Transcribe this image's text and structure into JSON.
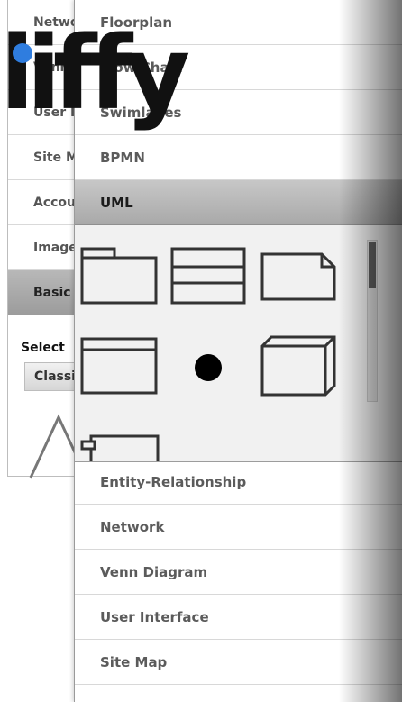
{
  "background_menu": {
    "items": [
      {
        "label": "Network"
      },
      {
        "label": "Venn Diagram"
      },
      {
        "label": "User Interface"
      },
      {
        "label": "Site Map"
      },
      {
        "label": "Account"
      },
      {
        "label": "Images"
      },
      {
        "label": "Basic"
      }
    ],
    "select_title": "Select",
    "select_value": "Classic"
  },
  "logo": {
    "text": "liffy",
    "brand_color": "#2f7ddf"
  },
  "menu": {
    "top_items": [
      {
        "label": "Floorplan"
      },
      {
        "label": "Flow Chart"
      },
      {
        "label": "Swimlanes"
      },
      {
        "label": "BPMN"
      },
      {
        "label": "UML"
      }
    ],
    "bottom_items": [
      {
        "label": "Entity-Relationship"
      },
      {
        "label": "Network"
      },
      {
        "label": "Venn Diagram"
      },
      {
        "label": "User Interface"
      },
      {
        "label": "Site Map"
      }
    ]
  },
  "uml_shapes": [
    {
      "name": "package-shape-icon"
    },
    {
      "name": "class-shape-icon"
    },
    {
      "name": "note-shape-icon"
    },
    {
      "name": "interface-shape-icon"
    },
    {
      "name": "initial-state-shape-icon"
    },
    {
      "name": "node-shape-icon"
    },
    {
      "name": "component-shape-icon"
    }
  ]
}
